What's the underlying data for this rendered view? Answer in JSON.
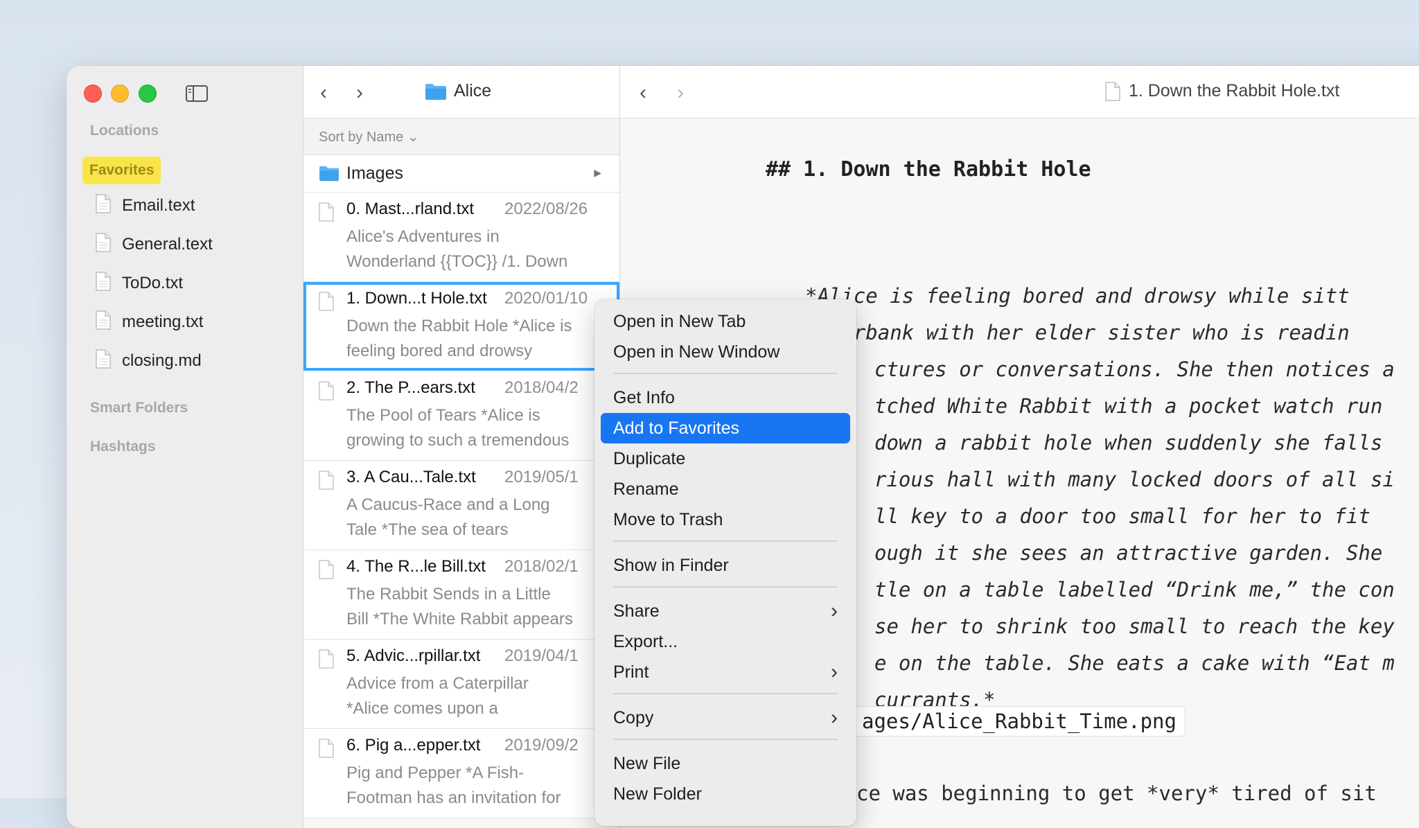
{
  "sidebar": {
    "locations_label": "Locations",
    "favorites_label": "Favorites",
    "favorites": [
      "Email.text",
      "General.text",
      "ToDo.txt",
      "meeting.txt",
      "closing.md"
    ],
    "smart_folders_label": "Smart Folders",
    "hashtags_label": "Hashtags"
  },
  "list": {
    "folder_name": "Alice",
    "sort_label": "Sort by Name",
    "images_row": "Images",
    "notes": [
      {
        "title": "0. Mast...rland.txt",
        "date": "2022/08/26",
        "excerpt": "Alice's Adventures in\nWonderland {{TOC}} /1. Down"
      },
      {
        "title": "1. Down...t Hole.txt",
        "date": "2020/01/10",
        "excerpt": "Down the Rabbit Hole *Alice is\nfeeling bored and drowsy"
      },
      {
        "title": "2. The P...ears.txt",
        "date": "2018/04/2",
        "excerpt": "The Pool of Tears *Alice is\ngrowing to such a tremendous"
      },
      {
        "title": "3. A Cau...Tale.txt",
        "date": "2019/05/1",
        "excerpt": "A Caucus-Race and a Long\nTale *The sea of tears"
      },
      {
        "title": "4. The R...le Bill.txt",
        "date": "2018/02/1",
        "excerpt": "The Rabbit Sends in a Little\nBill *The White Rabbit appears"
      },
      {
        "title": "5. Advic...rpillar.txt",
        "date": "2019/04/1",
        "excerpt": "Advice from a Caterpillar\n*Alice comes upon a"
      },
      {
        "title": "6. Pig a...epper.txt",
        "date": "2019/09/2",
        "excerpt": "Pig and Pepper *A Fish-\nFootman has an invitation for"
      }
    ]
  },
  "editor": {
    "file_title": "1. Down the Rabbit Hole.txt",
    "heading": "## 1. Down the Rabbit Hole",
    "lines": [
      "*Alice is feeling bored and drowsy while sitt",
      "riverbank with her elder sister who is readin",
      "ctures or conversations. She then notices a",
      "tched White Rabbit with a pocket watch run",
      "down a rabbit hole when suddenly she falls",
      "rious hall with many locked doors of all si",
      "ll key to a door too small for her to fit",
      "ough it she sees an attractive garden. She",
      "tle on a table labelled “Drink me,” the con",
      "se her to shrink too small to reach the key",
      "e on the table. She eats a cake with “Eat m",
      "currants.*"
    ],
    "code_text": "ages/Alice_Rabbit_Time.png",
    "last_line": "ce was beginning to get *very* tired of sit"
  },
  "context_menu": {
    "items": [
      {
        "label": "Open in New Tab"
      },
      {
        "label": "Open in New Window"
      },
      {
        "label": "Get Info"
      },
      {
        "label": "Add to Favorites"
      },
      {
        "label": "Duplicate"
      },
      {
        "label": "Rename"
      },
      {
        "label": "Move to Trash"
      },
      {
        "label": "Show in Finder"
      },
      {
        "label": "Share"
      },
      {
        "label": "Export..."
      },
      {
        "label": "Print"
      },
      {
        "label": "Copy"
      },
      {
        "label": "New File"
      },
      {
        "label": "New Folder"
      }
    ]
  },
  "colors": {
    "accent": "#1976f3",
    "selection_border": "#3aa6ff",
    "favorites_pill": "#fbe44a"
  }
}
